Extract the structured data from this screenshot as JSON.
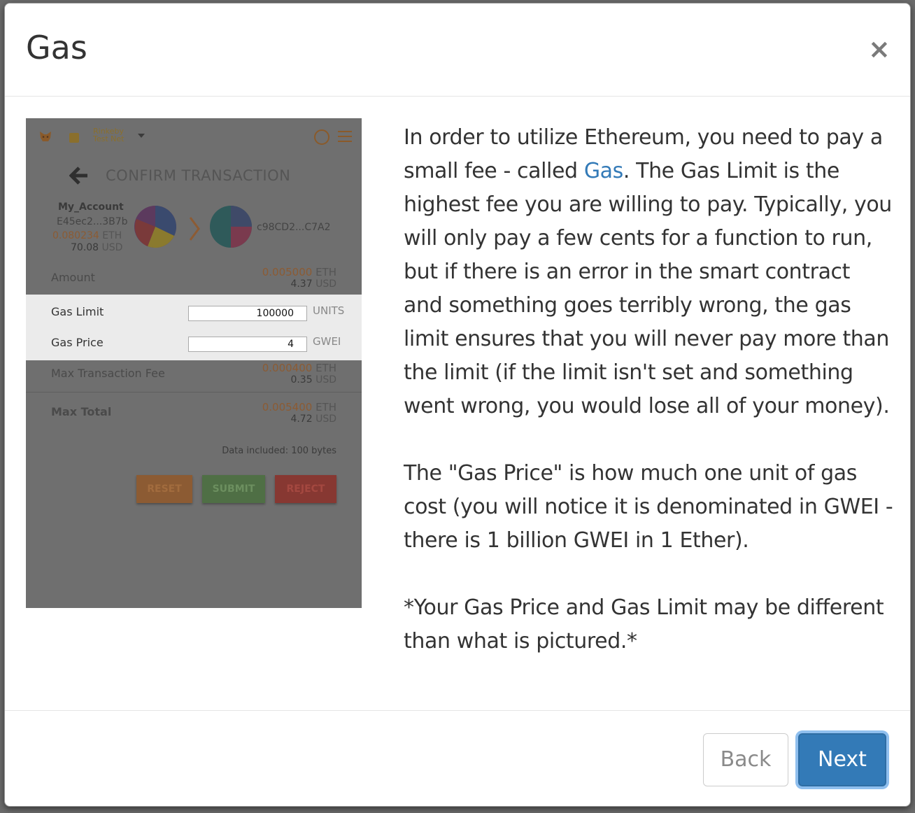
{
  "modal": {
    "title": "Gas",
    "close_label": "×"
  },
  "screenshot": {
    "network_name_line1": "Rinkeby",
    "network_name_line2": "Test Net",
    "confirm_title": "CONFIRM TRANSACTION",
    "from_account_name": "My_Account",
    "from_address": "E45ec2...3B7b",
    "from_eth_value": "0.080234",
    "from_eth_unit": "ETH",
    "from_usd_value": "70.08",
    "from_usd_unit": "USD",
    "to_address": "c98CD2...C7A2",
    "amount_label": "Amount",
    "amount_eth": "0.005000",
    "amount_eth_unit": "ETH",
    "amount_usd": "4.37",
    "amount_usd_unit": "USD",
    "gas_limit_label": "Gas Limit",
    "gas_limit_value": "100000",
    "gas_limit_unit": "UNITS",
    "gas_price_label": "Gas Price",
    "gas_price_value": "4",
    "gas_price_unit": "GWEI",
    "max_fee_label": "Max Transaction Fee",
    "max_fee_eth": "0.000400",
    "max_fee_eth_unit": "ETH",
    "max_fee_usd": "0.35",
    "max_fee_usd_unit": "USD",
    "max_total_label": "Max Total",
    "max_total_eth": "0.005400",
    "max_total_eth_unit": "ETH",
    "max_total_usd": "4.72",
    "max_total_usd_unit": "USD",
    "data_included": "Data included: 100 bytes",
    "reset_label": "RESET",
    "submit_label": "SUBMIT",
    "reject_label": "REJECT"
  },
  "description": {
    "p1_before_link": "In order to utilize Ethereum, you need to pay a small fee - called ",
    "p1_link": "Gas",
    "p1_after_link": ". The Gas Limit is the highest fee you are willing to pay. Typically, you will only pay a few cents for a function to run, but if there is an error in the smart contract and something goes terribly wrong, the gas limit ensures that you will never pay more than the limit (if the limit isn't set and something went wrong, you would lose all of your money).",
    "p2": "The \"Gas Price\" is how much one unit of gas cost (you will notice it is denominated in GWEI - there is 1 billion GWEI in 1 Ether).",
    "p3": "*Your Gas Price and Gas Limit may be different than what is pictured.*"
  },
  "footer": {
    "back_label": "Back",
    "next_label": "Next"
  },
  "colors": {
    "accent": "#337ab7",
    "focus_ring": "#8fbfee",
    "overlay": "#6f6f6f",
    "gas_panel": "#ebebeb"
  }
}
